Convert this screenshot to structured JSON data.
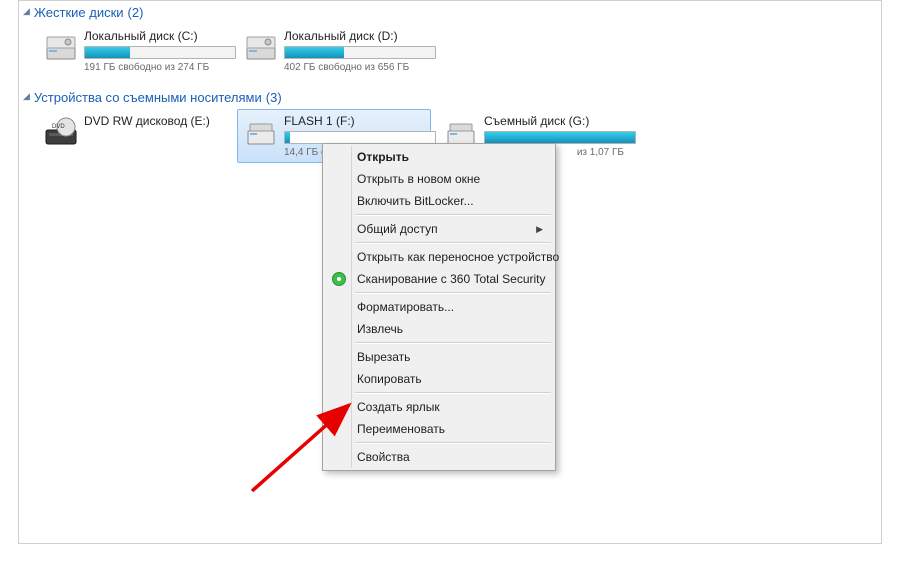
{
  "groups": {
    "hdd": {
      "title": "Жесткие диски",
      "count": "(2)"
    },
    "removable": {
      "title": "Устройства со съемными носителями",
      "count": "(3)"
    }
  },
  "drives": {
    "c": {
      "name": "Локальный диск (C:)",
      "stats": "191 ГБ свободно из 274 ГБ",
      "fill_pct": 30
    },
    "d": {
      "name": "Локальный диск (D:)",
      "stats": "402 ГБ свободно из 656 ГБ",
      "fill_pct": 39
    },
    "dvd": {
      "name": "DVD RW дисковод (E:)"
    },
    "flash": {
      "name": "FLASH 1 (F:)",
      "stats_visible": "14,4 ГБ св",
      "fill_pct": 3
    },
    "g": {
      "name": "Съемный диск (G:)",
      "stats_suffix": "из 1,07 ГБ",
      "fill_pct": 100
    }
  },
  "context_menu": {
    "open": "Открыть",
    "open_new_window": "Открыть в новом окне",
    "bitlocker": "Включить BitLocker...",
    "share": "Общий доступ",
    "open_portable": "Открыть как переносное устройство",
    "scan_360": "Сканирование с 360 Total Security",
    "format": "Форматировать...",
    "eject": "Извлечь",
    "cut": "Вырезать",
    "copy": "Копировать",
    "shortcut": "Создать ярлык",
    "rename": "Переименовать",
    "properties": "Свойства"
  }
}
